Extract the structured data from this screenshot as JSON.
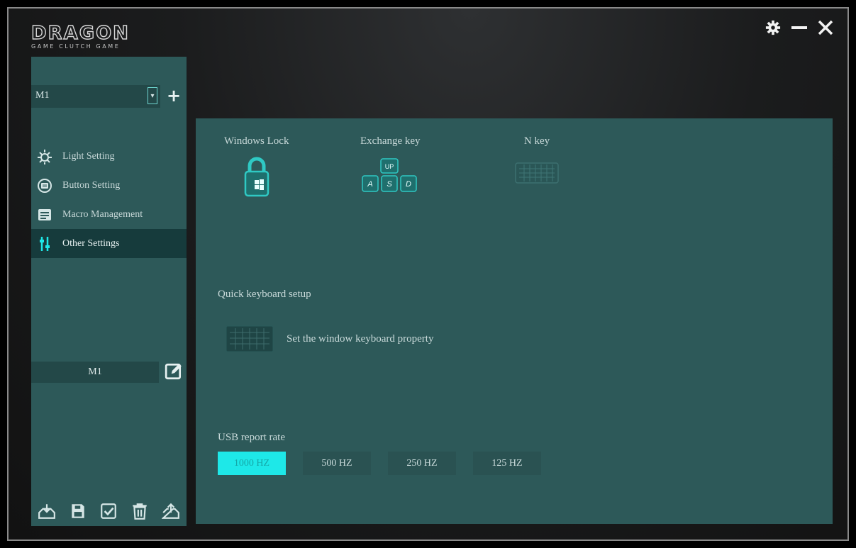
{
  "logo": {
    "main": "DRAGON",
    "sub": "GAME CLUTCH GAME"
  },
  "window": {
    "controls": [
      "gear-icon",
      "minimize-icon",
      "close-icon"
    ]
  },
  "sidebar": {
    "profile": {
      "selected": "M1",
      "dropdown_icon": "chevron-down-icon",
      "add_icon": "plus-icon"
    },
    "menu": [
      {
        "label": "Light Setting",
        "icon": "light-icon",
        "active": false
      },
      {
        "label": "Button Setting",
        "icon": "button-icon",
        "active": false
      },
      {
        "label": "Macro Management",
        "icon": "macro-icon",
        "active": false
      },
      {
        "label": "Other Settings",
        "icon": "sliders-icon",
        "active": true
      }
    ],
    "profile_name": "M1",
    "bottom_icons": [
      "import-icon",
      "save-icon",
      "apply-icon",
      "delete-icon",
      "export-icon"
    ]
  },
  "main": {
    "features": [
      {
        "label": "Windows Lock",
        "icon": "windows-lock-icon"
      },
      {
        "label": "Exchange key",
        "icon": "exchange-key-icon"
      },
      {
        "label": "N key",
        "icon": "n-key-icon"
      }
    ],
    "exchange_keys": {
      "top": "UP",
      "bottom": [
        "A",
        "S",
        "D"
      ]
    },
    "quick_setup": {
      "title": "Quick keyboard setup",
      "text": "Set the window keyboard property"
    },
    "usb_rate": {
      "title": "USB report rate",
      "options": [
        "1000 HZ",
        "500 HZ",
        "250 HZ",
        "125 HZ"
      ],
      "selected": "1000 HZ"
    }
  },
  "colors": {
    "accent": "#1ee8e8",
    "panel": "#2d5959",
    "panel_dark": "#163b3c",
    "background": "#1b1c1d"
  }
}
